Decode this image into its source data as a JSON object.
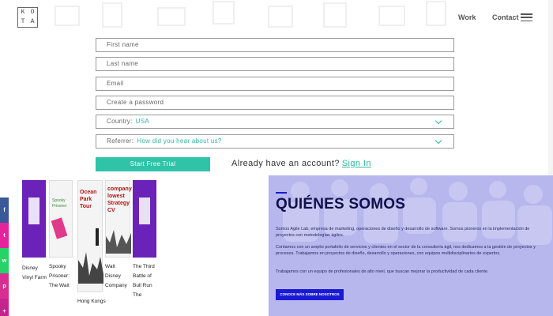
{
  "header": {
    "logo_letters": [
      "K",
      "O",
      "T",
      "A"
    ],
    "nav": {
      "work": "Work",
      "contact": "Contact"
    }
  },
  "form": {
    "first_name_placeholder": "First name",
    "last_name_placeholder": "Last name",
    "email_placeholder": "Email",
    "password_placeholder": "Create a password",
    "country_label": "Country:",
    "country_value": "USA",
    "referrer_label": "Referrer:",
    "referrer_value": "How did you hear about us?",
    "submit_label": "Start Free Trial",
    "already_text": "Already have an account?",
    "signin_link": "Sign In"
  },
  "social": [
    {
      "icon": "facebook-icon",
      "glyph": "f",
      "color": "#3b5998"
    },
    {
      "icon": "twitter-icon",
      "glyph": "t",
      "color": "#e5249c"
    },
    {
      "icon": "whatsapp-icon",
      "glyph": "w",
      "color": "#25d366"
    },
    {
      "icon": "pinterest-icon",
      "glyph": "p",
      "color": "#d92d91"
    },
    {
      "icon": "share-icon",
      "glyph": "+",
      "color": "#c7238e"
    }
  ],
  "games": {
    "g1_title": "Disney Vinyl Farm",
    "g2_title": "Spooky Prisoner: The Wait",
    "g3_tile": "Ocean Park Tour",
    "g3_title": "Hong Kongs",
    "g4_tile": "company lowest Strategy CV",
    "g4_title": "Walt Disney Company",
    "g5_title": "The Third Battle of Bull Run The"
  },
  "about": {
    "heading": "QUIÉNES SOMOS",
    "p1": "Somos Agile Lab, empresa de marketing, operaciones de diseño y desarrollo de software. Somos pioneros en la implementación de proyectos con metodologías ágiles.",
    "p2": "Contamos con un amplio portafolio de servicios y clientes en el sector de la consultoría ágil, nos dedicamos a la gestión de proyectos y procesos. Trabajamos en proyectos de diseño, desarrollo y operaciones, con equipos multidisciplinarios de expertos.",
    "p3": "Trabajamos con un equipo de profesionales de alto nivel, que buscan mejorar la productividad de cada cliente.",
    "button": "CONOCE MÁS SOBRE NOSOTROS",
    "accent_color": "#1a1ad4"
  }
}
